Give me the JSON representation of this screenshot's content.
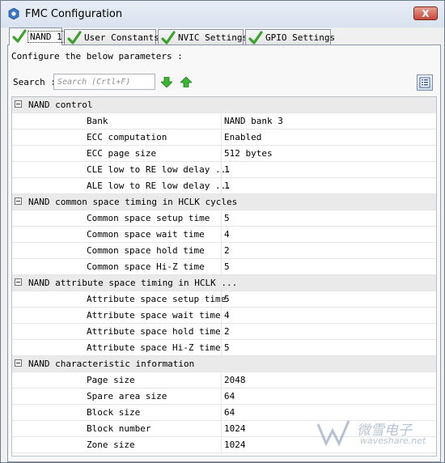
{
  "window": {
    "title": "FMC Configuration",
    "close_label": "X"
  },
  "tabs": [
    {
      "label": "NAND 1",
      "active": true
    },
    {
      "label": "User Constants",
      "active": false
    },
    {
      "label": "NVIC Settings",
      "active": false
    },
    {
      "label": "GPIO Settings",
      "active": false
    }
  ],
  "panel": {
    "instructions": "Configure the below parameters :",
    "search_label": "Search :",
    "search_placeholder": "Search (Crtl+F)",
    "search_value": ""
  },
  "groups": [
    {
      "name": "NAND control",
      "params": [
        {
          "name": "Bank",
          "value": "NAND bank 3"
        },
        {
          "name": "ECC computation",
          "value": "Enabled"
        },
        {
          "name": "ECC page size",
          "value": "512 bytes"
        },
        {
          "name": "CLE low to RE low delay ...",
          "value": "1"
        },
        {
          "name": "ALE low to RE low delay ...",
          "value": "1"
        }
      ]
    },
    {
      "name": "NAND common space timing in HCLK cycles",
      "params": [
        {
          "name": "Common space setup time",
          "value": "5"
        },
        {
          "name": "Common space wait time",
          "value": "4"
        },
        {
          "name": "Common space hold time",
          "value": "2"
        },
        {
          "name": "Common space Hi-Z time",
          "value": "5"
        }
      ]
    },
    {
      "name": "NAND attribute space timing in HCLK ...",
      "params": [
        {
          "name": "Attribute space setup time",
          "value": "5"
        },
        {
          "name": "Attribute space wait time",
          "value": "4"
        },
        {
          "name": "Attribute space hold time",
          "value": "2"
        },
        {
          "name": "Attribute space Hi-Z time",
          "value": "5"
        }
      ]
    },
    {
      "name": "NAND characteristic information",
      "params": [
        {
          "name": "Page size",
          "value": "2048"
        },
        {
          "name": "Spare area size",
          "value": "64"
        },
        {
          "name": "Block size",
          "value": "64"
        },
        {
          "name": "Block number",
          "value": "1024"
        },
        {
          "name": "Zone size",
          "value": "1024"
        }
      ]
    }
  ],
  "watermark": {
    "text": "微雪电子",
    "sub": "waveshare.net"
  },
  "colors": {
    "check_green": "#3aa12b",
    "arrow_green": "#3bb534",
    "group_bg": "#eaeaea",
    "titlebar": "#dde6f1"
  },
  "icons": {
    "title": "fmc-app-icon",
    "tab": "green-check-icon",
    "down": "arrow-down-icon",
    "up": "arrow-up-icon",
    "view": "list-view-icon",
    "expander": "collapse-minus-icon"
  }
}
